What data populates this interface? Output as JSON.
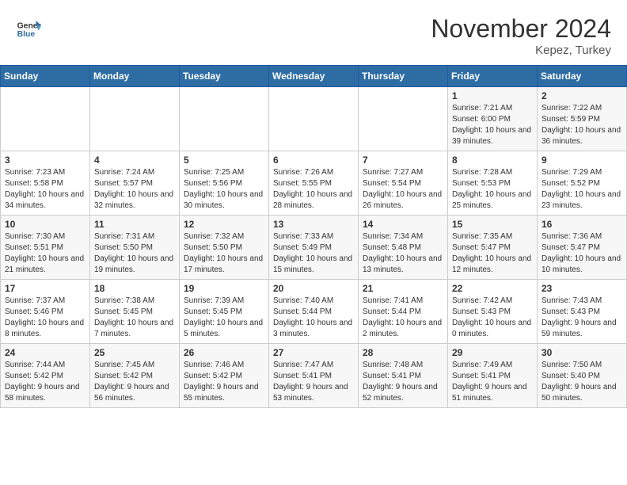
{
  "header": {
    "logo_line1": "General",
    "logo_line2": "Blue",
    "month": "November 2024",
    "location": "Kepez, Turkey"
  },
  "weekdays": [
    "Sunday",
    "Monday",
    "Tuesday",
    "Wednesday",
    "Thursday",
    "Friday",
    "Saturday"
  ],
  "weeks": [
    [
      {
        "day": "",
        "info": ""
      },
      {
        "day": "",
        "info": ""
      },
      {
        "day": "",
        "info": ""
      },
      {
        "day": "",
        "info": ""
      },
      {
        "day": "",
        "info": ""
      },
      {
        "day": "1",
        "info": "Sunrise: 7:21 AM\nSunset: 6:00 PM\nDaylight: 10 hours and 39 minutes."
      },
      {
        "day": "2",
        "info": "Sunrise: 7:22 AM\nSunset: 5:59 PM\nDaylight: 10 hours and 36 minutes."
      }
    ],
    [
      {
        "day": "3",
        "info": "Sunrise: 7:23 AM\nSunset: 5:58 PM\nDaylight: 10 hours and 34 minutes."
      },
      {
        "day": "4",
        "info": "Sunrise: 7:24 AM\nSunset: 5:57 PM\nDaylight: 10 hours and 32 minutes."
      },
      {
        "day": "5",
        "info": "Sunrise: 7:25 AM\nSunset: 5:56 PM\nDaylight: 10 hours and 30 minutes."
      },
      {
        "day": "6",
        "info": "Sunrise: 7:26 AM\nSunset: 5:55 PM\nDaylight: 10 hours and 28 minutes."
      },
      {
        "day": "7",
        "info": "Sunrise: 7:27 AM\nSunset: 5:54 PM\nDaylight: 10 hours and 26 minutes."
      },
      {
        "day": "8",
        "info": "Sunrise: 7:28 AM\nSunset: 5:53 PM\nDaylight: 10 hours and 25 minutes."
      },
      {
        "day": "9",
        "info": "Sunrise: 7:29 AM\nSunset: 5:52 PM\nDaylight: 10 hours and 23 minutes."
      }
    ],
    [
      {
        "day": "10",
        "info": "Sunrise: 7:30 AM\nSunset: 5:51 PM\nDaylight: 10 hours and 21 minutes."
      },
      {
        "day": "11",
        "info": "Sunrise: 7:31 AM\nSunset: 5:50 PM\nDaylight: 10 hours and 19 minutes."
      },
      {
        "day": "12",
        "info": "Sunrise: 7:32 AM\nSunset: 5:50 PM\nDaylight: 10 hours and 17 minutes."
      },
      {
        "day": "13",
        "info": "Sunrise: 7:33 AM\nSunset: 5:49 PM\nDaylight: 10 hours and 15 minutes."
      },
      {
        "day": "14",
        "info": "Sunrise: 7:34 AM\nSunset: 5:48 PM\nDaylight: 10 hours and 13 minutes."
      },
      {
        "day": "15",
        "info": "Sunrise: 7:35 AM\nSunset: 5:47 PM\nDaylight: 10 hours and 12 minutes."
      },
      {
        "day": "16",
        "info": "Sunrise: 7:36 AM\nSunset: 5:47 PM\nDaylight: 10 hours and 10 minutes."
      }
    ],
    [
      {
        "day": "17",
        "info": "Sunrise: 7:37 AM\nSunset: 5:46 PM\nDaylight: 10 hours and 8 minutes."
      },
      {
        "day": "18",
        "info": "Sunrise: 7:38 AM\nSunset: 5:45 PM\nDaylight: 10 hours and 7 minutes."
      },
      {
        "day": "19",
        "info": "Sunrise: 7:39 AM\nSunset: 5:45 PM\nDaylight: 10 hours and 5 minutes."
      },
      {
        "day": "20",
        "info": "Sunrise: 7:40 AM\nSunset: 5:44 PM\nDaylight: 10 hours and 3 minutes."
      },
      {
        "day": "21",
        "info": "Sunrise: 7:41 AM\nSunset: 5:44 PM\nDaylight: 10 hours and 2 minutes."
      },
      {
        "day": "22",
        "info": "Sunrise: 7:42 AM\nSunset: 5:43 PM\nDaylight: 10 hours and 0 minutes."
      },
      {
        "day": "23",
        "info": "Sunrise: 7:43 AM\nSunset: 5:43 PM\nDaylight: 9 hours and 59 minutes."
      }
    ],
    [
      {
        "day": "24",
        "info": "Sunrise: 7:44 AM\nSunset: 5:42 PM\nDaylight: 9 hours and 58 minutes."
      },
      {
        "day": "25",
        "info": "Sunrise: 7:45 AM\nSunset: 5:42 PM\nDaylight: 9 hours and 56 minutes."
      },
      {
        "day": "26",
        "info": "Sunrise: 7:46 AM\nSunset: 5:42 PM\nDaylight: 9 hours and 55 minutes."
      },
      {
        "day": "27",
        "info": "Sunrise: 7:47 AM\nSunset: 5:41 PM\nDaylight: 9 hours and 53 minutes."
      },
      {
        "day": "28",
        "info": "Sunrise: 7:48 AM\nSunset: 5:41 PM\nDaylight: 9 hours and 52 minutes."
      },
      {
        "day": "29",
        "info": "Sunrise: 7:49 AM\nSunset: 5:41 PM\nDaylight: 9 hours and 51 minutes."
      },
      {
        "day": "30",
        "info": "Sunrise: 7:50 AM\nSunset: 5:40 PM\nDaylight: 9 hours and 50 minutes."
      }
    ]
  ]
}
